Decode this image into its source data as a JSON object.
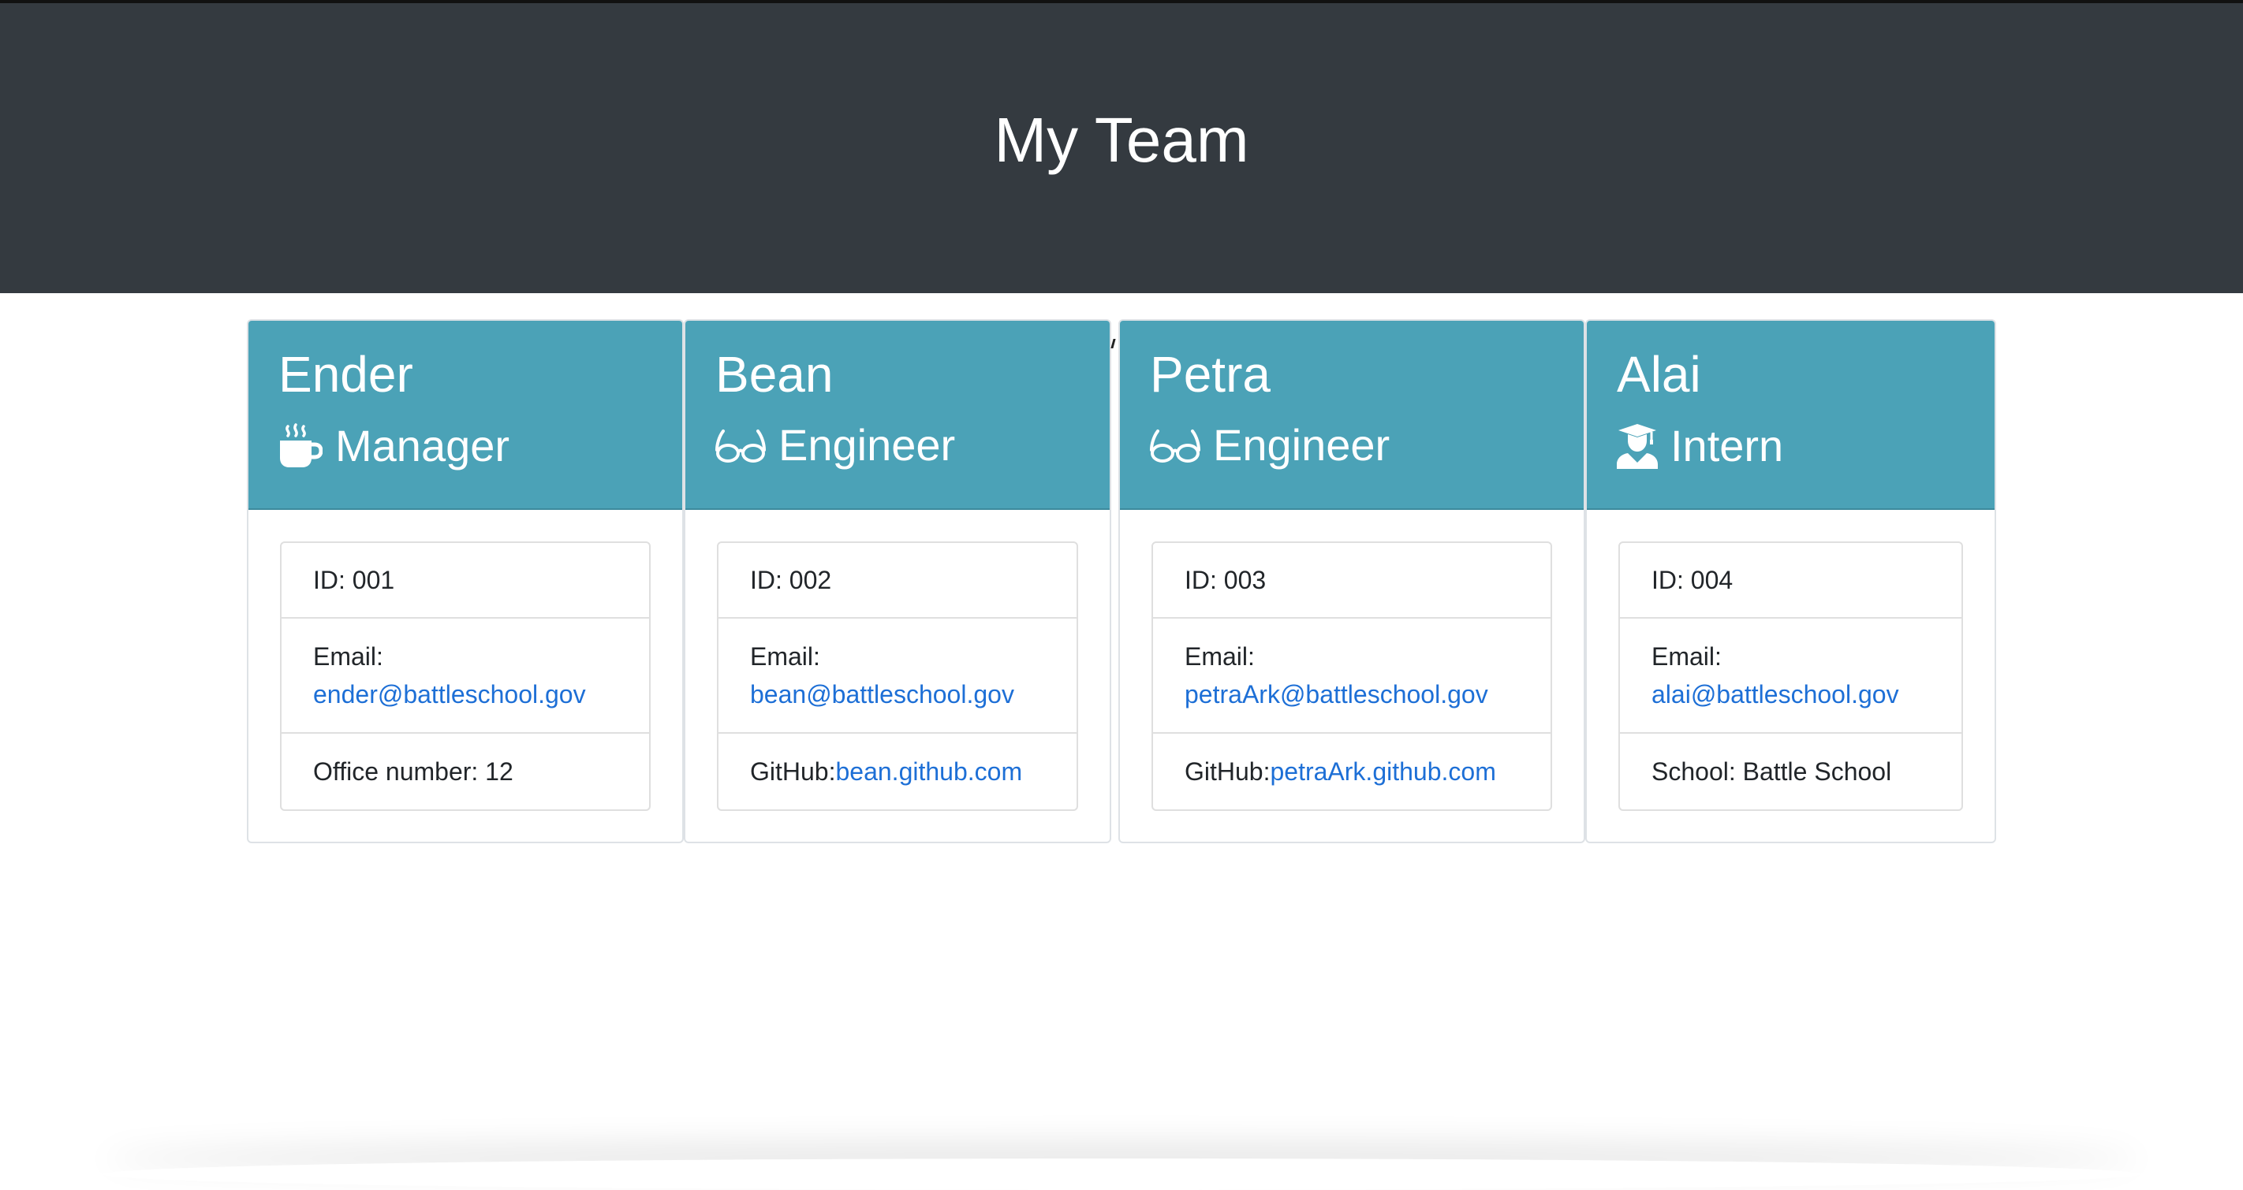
{
  "page": {
    "title": "My Team"
  },
  "colors": {
    "header_bg": "#343a40",
    "card_header_bg": "#4ba2b7",
    "link": "#1d6fd6"
  },
  "team": [
    {
      "name": "Ender",
      "role": "Manager",
      "icon": "mug-icon",
      "id": "ID: 001",
      "email_label": "Email:",
      "email": "ender@battleschool.gov",
      "extra_label": "Office number: 12",
      "extra_link": ""
    },
    {
      "name": "Bean",
      "role": "Engineer",
      "icon": "glasses-icon",
      "id": "ID: 002",
      "email_label": "Email:",
      "email": "bean@battleschool.gov",
      "extra_label": "GitHub: ",
      "extra_link": "bean.github.com"
    },
    {
      "name": "Petra",
      "role": "Engineer",
      "icon": "glasses-icon",
      "id": "ID: 003",
      "email_label": "Email:",
      "email": "petraArk@battleschool.gov",
      "extra_label": "GitHub: ",
      "extra_link": "petraArk.github.com"
    },
    {
      "name": "Alai",
      "role": "Intern",
      "icon": "graduate-icon",
      "id": "ID: 004",
      "email_label": "Email:",
      "email": "alai@battleschool.gov",
      "extra_label": "School: Battle School",
      "extra_link": ""
    }
  ]
}
